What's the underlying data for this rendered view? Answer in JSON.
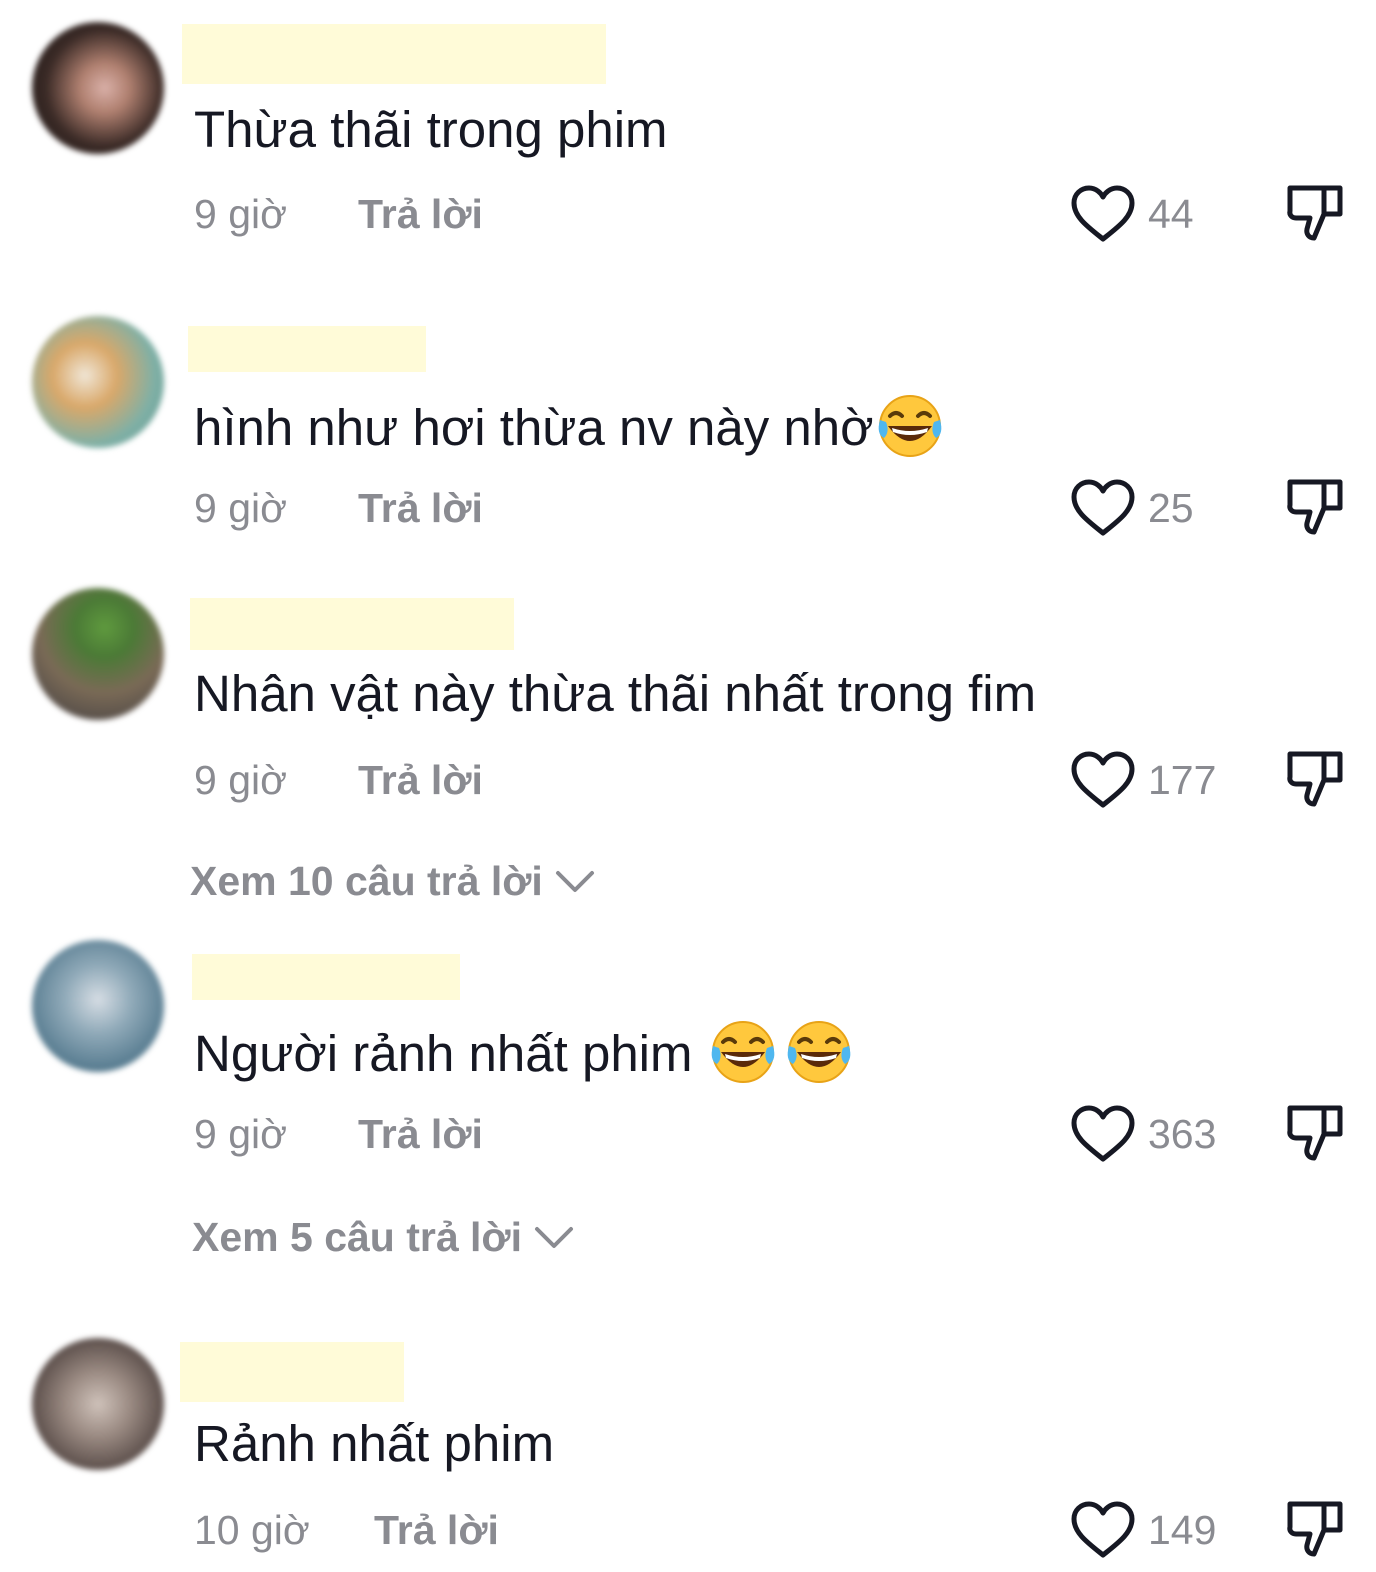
{
  "colors": {
    "text": "#161823",
    "secondary": "#8a8b91",
    "redaction": "#fffbd8"
  },
  "comments": [
    {
      "text": "Thừa thãi trong phim",
      "time": "9 giờ",
      "reply": "Trả lời",
      "likes": "44",
      "emoji_count": 0
    },
    {
      "text": "hình như hơi thừa nv này nhờ",
      "time": "9 giờ",
      "reply": "Trả lời",
      "likes": "25",
      "emoji_count": 1
    },
    {
      "text": "Nhân vật này thừa thãi nhất trong fim",
      "time": "9 giờ",
      "reply": "Trả lời",
      "likes": "177",
      "view_replies": "Xem 10 câu trả lời",
      "emoji_count": 0
    },
    {
      "text": "Người rảnh nhất phim ",
      "time": "9 giờ",
      "reply": "Trả lời",
      "likes": "363",
      "view_replies": "Xem 5 câu trả lời",
      "emoji_count": 2
    },
    {
      "text": "Rảnh nhất phim",
      "time": "10 giờ",
      "reply": "Trả lời",
      "likes": "149",
      "emoji_count": 0
    }
  ],
  "icons": {
    "like": "heart-outline-icon",
    "dislike": "thumbs-down-icon",
    "expand": "chevron-down-icon",
    "emoji": "face-with-tears-of-joy-emoji"
  }
}
